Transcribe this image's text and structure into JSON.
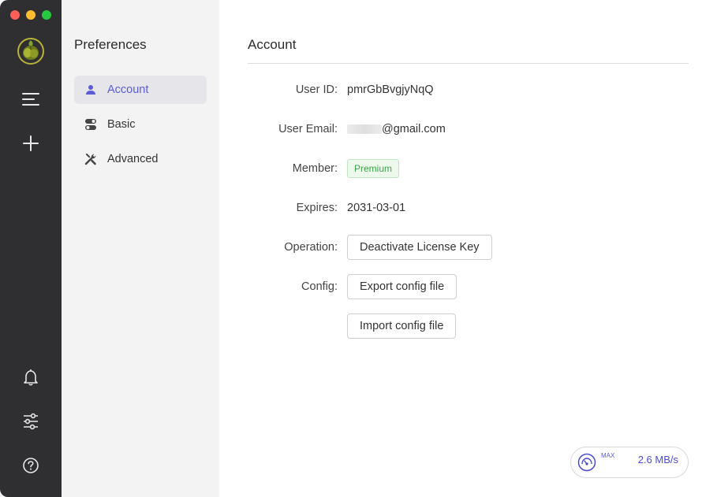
{
  "colors": {
    "rail_bg": "#2f2f31",
    "sidebar_bg": "#f3f3f4",
    "accent": "#5b5bd6",
    "premium_text": "#3ea34a",
    "premium_bg": "#eef9ee"
  },
  "rail": {
    "logo_icon": "olive-logo-icon",
    "buttons": [
      {
        "icon": "menu-icon"
      },
      {
        "icon": "plus-icon"
      },
      {
        "icon": "bell-icon"
      },
      {
        "icon": "sliders-icon"
      },
      {
        "icon": "help-icon"
      }
    ]
  },
  "sidebar": {
    "title": "Preferences",
    "items": [
      {
        "label": "Account",
        "icon": "user-icon",
        "active": true
      },
      {
        "label": "Basic",
        "icon": "toggle-icon",
        "active": false
      },
      {
        "label": "Advanced",
        "icon": "tools-icon",
        "active": false
      }
    ]
  },
  "main": {
    "title": "Account",
    "user_id_label": "User ID:",
    "user_id": "pmrGbBvgjyNqQ",
    "email_label": "User Email:",
    "email_suffix": "@gmail.com",
    "member_label": "Member:",
    "member_badge": "Premium",
    "expires_label": "Expires:",
    "expires": "2031-03-01",
    "operation_label": "Operation:",
    "deactivate_button": "Deactivate License Key",
    "config_label": "Config:",
    "export_button": "Export config file",
    "import_button": "Import config file"
  },
  "speed": {
    "icon": "speedometer-icon",
    "max_label": "MAX",
    "value": "2.6 MB/s"
  }
}
